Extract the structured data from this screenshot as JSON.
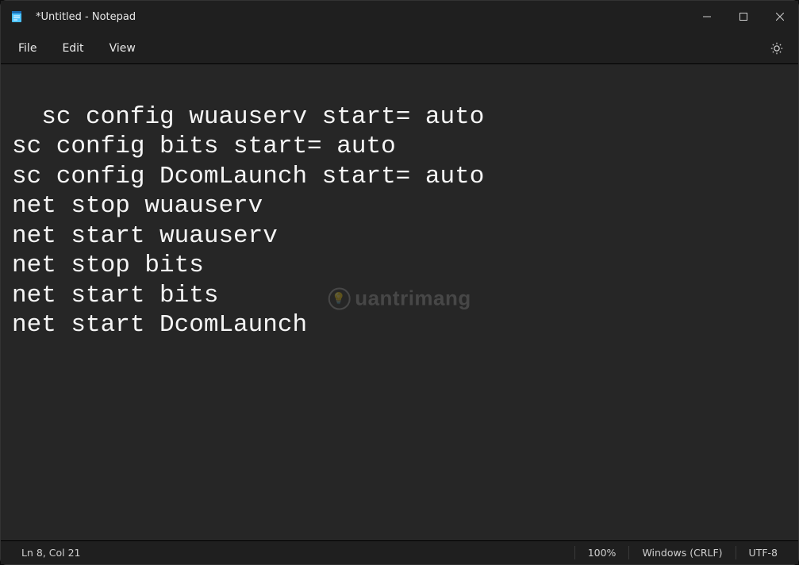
{
  "window": {
    "title": "*Untitled - Notepad"
  },
  "menu": {
    "file": "File",
    "edit": "Edit",
    "view": "View"
  },
  "editor": {
    "content": "sc config wuauserv start= auto\nsc config bits start= auto\nsc config DcomLaunch start= auto\nnet stop wuauserv\nnet start wuauserv\nnet stop bits\nnet start bits\nnet start DcomLaunch"
  },
  "watermark": {
    "text": "uantrimang"
  },
  "status": {
    "position": "Ln 8, Col 21",
    "zoom": "100%",
    "line_ending": "Windows (CRLF)",
    "encoding": "UTF-8"
  }
}
